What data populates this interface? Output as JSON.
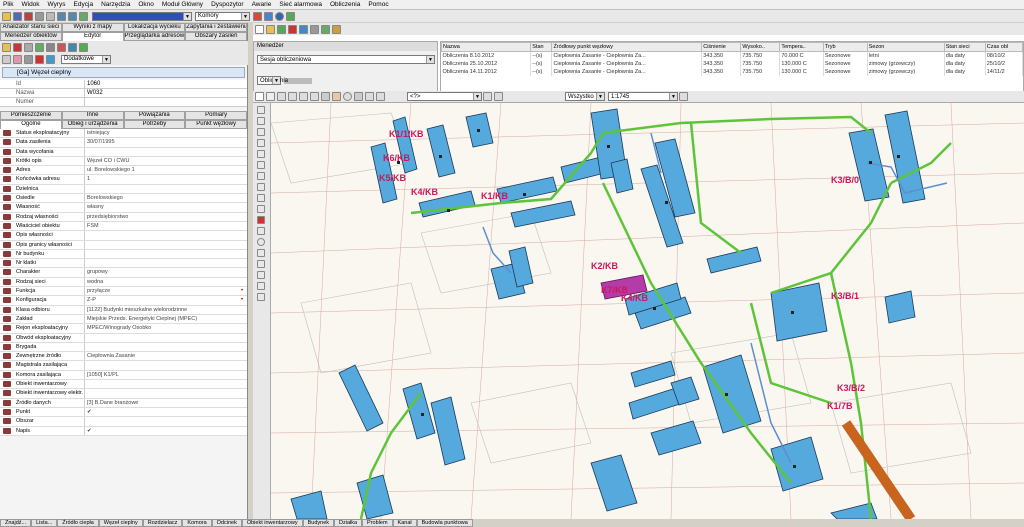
{
  "menu": [
    "Plik",
    "Widok",
    "Wyrys",
    "Edycja",
    "Narzędzia",
    "Okno",
    "Moduł Główny",
    "Dyspozytor",
    "Awarie",
    "Sieć alarmowa",
    "Obliczenia",
    "Pomoc"
  ],
  "toolbar": {
    "combo1": "",
    "combo2": "Komory"
  },
  "left_tabs_row1": [
    "Analizator stanu sieci",
    "Wyniki z mapy",
    "Lokalizacja wycieku",
    "Zapytania i zestawienia"
  ],
  "left_tabs_row2": [
    "Menedżer obiektów",
    "Edytor",
    "Przeglądarka adresów",
    "Obszary zasileń"
  ],
  "left_toolbar": {
    "dodatkowe": "Dodatkowe"
  },
  "selected": "[Ga] Węzeł cieplny",
  "id_fields": [
    {
      "label": "Id",
      "value": "1060"
    },
    {
      "label": "Nazwa",
      "value": "W032"
    },
    {
      "label": "Numer",
      "value": ""
    }
  ],
  "prop_tabs_row1": [
    "Pomieszczenie",
    "Inne",
    "Powiązania",
    "Pomiary"
  ],
  "prop_tabs_row2": [
    "Ogólne",
    "Obieg i urządzenia",
    "Potrzeby",
    "Punkt węzłowy"
  ],
  "properties": [
    {
      "label": "Status eksploatacyjny",
      "value": "istniejący",
      "mark": ""
    },
    {
      "label": "Data zasilenia",
      "value": "30/07/1995",
      "mark": ""
    },
    {
      "label": "Data wycofania",
      "value": "",
      "mark": ""
    },
    {
      "label": "Krótki opis",
      "value": "Węzeł CO i CWU",
      "mark": ""
    },
    {
      "label": "Adres",
      "value": "ul. Borelowskiego 1",
      "mark": ""
    },
    {
      "label": "Końcówka adresu",
      "value": "1",
      "mark": ""
    },
    {
      "label": "Dzielnica",
      "value": "",
      "mark": ""
    },
    {
      "label": "Osiedle",
      "value": "Borelowskiego",
      "mark": ""
    },
    {
      "label": "Własność",
      "value": "własny",
      "mark": ""
    },
    {
      "label": "Rodzaj własności",
      "value": "przedsiębiorstwo",
      "mark": ""
    },
    {
      "label": "Właściciel obiektu",
      "value": "FSM",
      "mark": ""
    },
    {
      "label": "Opis własności",
      "value": "",
      "mark": ""
    },
    {
      "label": "Opis granicy własności",
      "value": "",
      "mark": ""
    },
    {
      "label": "Nr budynku",
      "value": "",
      "mark": ""
    },
    {
      "label": "Nr klatki",
      "value": "",
      "mark": ""
    },
    {
      "label": "Charakter",
      "value": "grupowy",
      "mark": ""
    },
    {
      "label": "Rodzaj sieci",
      "value": "wodna",
      "mark": ""
    },
    {
      "label": "Funkcja",
      "value": "przyłącze",
      "mark": "•"
    },
    {
      "label": "Konfiguracja",
      "value": "Z-P",
      "mark": "•"
    },
    {
      "label": "Klasa odbioru",
      "value": "[1122] Budynki mieszkalne wielorodzinne",
      "mark": ""
    },
    {
      "label": "Zakład",
      "value": "Miejskie Przeds. Energetyki Cieplnej (MPEC)",
      "mark": ""
    },
    {
      "label": "Rejon eksploatacyjny",
      "value": "MPEC/Winogrady Osobko",
      "mark": ""
    },
    {
      "label": "Obwód eksploatacyjny",
      "value": "",
      "mark": ""
    },
    {
      "label": "Brygada",
      "value": "",
      "mark": ""
    },
    {
      "label": "Zewnętrzne źródło",
      "value": "Ciepłownia Zasanie",
      "mark": ""
    },
    {
      "label": "Magistrala zasilająca",
      "value": "",
      "mark": ""
    },
    {
      "label": "Komora zasilająca",
      "value": "[1050] K1/PL",
      "mark": ""
    },
    {
      "label": "Obiekt inwentarzowy",
      "value": "",
      "mark": ""
    },
    {
      "label": "Obiekt inwentarzowy elektr.",
      "value": "",
      "mark": ""
    },
    {
      "label": "Źródło danych",
      "value": "[3] B.Dane branżowe",
      "mark": ""
    },
    {
      "label": "Punkt",
      "value": "✔",
      "mark": ""
    },
    {
      "label": "Obszar",
      "value": "",
      "mark": ""
    },
    {
      "label": "Napis",
      "value": "✔",
      "mark": ""
    }
  ],
  "menadzer": {
    "title": "Menedżer",
    "session": "Sesja obliczeniowa",
    "btn": "Obliczenia"
  },
  "calc_table": {
    "headers": [
      "Nazwa",
      "Stan",
      "Źródłowy punkt węzłowy",
      "Ciśnienie",
      "Wysoko..",
      "Tempera..",
      "Tryb",
      "Sezon",
      "Stan sieci",
      "Czas obl"
    ],
    "rows": [
      [
        "Obliczenia 8.10.2012",
        "--(s)",
        "Ciepłownia Zasanie - Ciepłownia Za...",
        "343.350",
        "735.750",
        "70.000 C",
        "Sezonowe",
        "letni",
        "dla daty",
        "08/10/2"
      ],
      [
        "Obliczenia 25.10.2012",
        "--(s)",
        "Ciepłownia Zasanie - Ciepłownia Za...",
        "343.350",
        "735.750",
        "130.000 C",
        "Sezonowe",
        "zimowy (grzewczy)",
        "dla daty",
        "25/10/2"
      ],
      [
        "Obliczenia 14.11.2012",
        "--(s)",
        "Ciepłownia Zasanie - Ciepłownia Za...",
        "343.350",
        "735.750",
        "130.000 C",
        "Sezonowe",
        "zimowy (grzewczy)",
        "dla daty",
        "14/11/2"
      ]
    ]
  },
  "map_toolbar": {
    "combo_a": "<?>",
    "combo_b": "Wszystko",
    "scale": "1:1745"
  },
  "map_labels": [
    "K1/1/KB",
    "K6/KB",
    "K5/KB",
    "K4/KB",
    "K1/KB",
    "K3/B/0",
    "K2/KB",
    "K3/B/1",
    "K3/B/2",
    "K1/7B",
    "K7/KB",
    "K4/KB"
  ],
  "bottom_tabs": [
    "Znajdź...",
    "Lista...",
    "Źródło ciepła",
    "Węzeł cieplny",
    "Rozdzielacz",
    "Komora",
    "Odcinek",
    "Obiekt inwentarzowy",
    "Budynek",
    "Działka",
    "Problem",
    "Kanał",
    "Budowla punktowa"
  ],
  "colors": {
    "building": "#56a9dc",
    "pipe_green": "#5ec43a",
    "pipe_orange": "#c8641e",
    "label_red": "#d0155a",
    "highlight": "#b43ca8"
  }
}
